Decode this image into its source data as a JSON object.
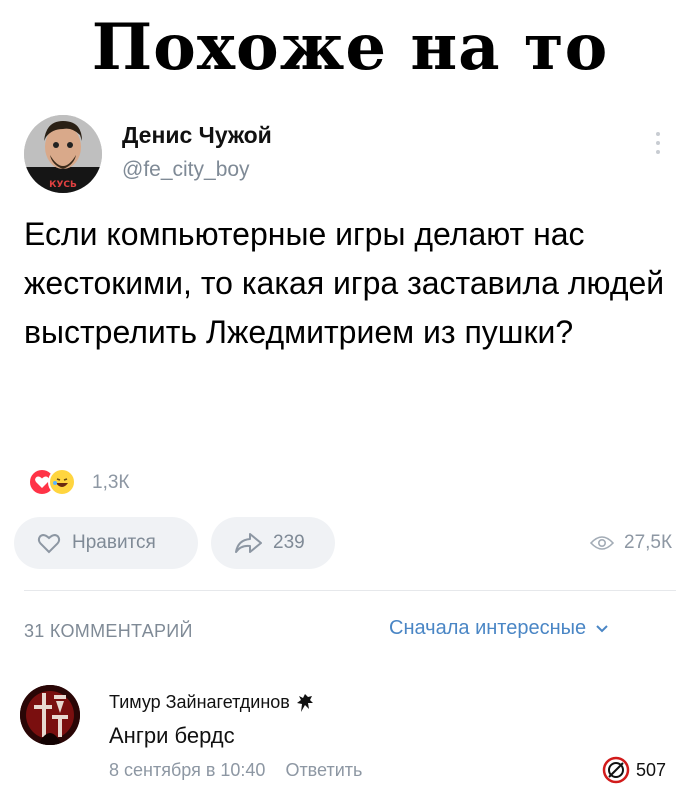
{
  "meme_caption": "Похоже на то",
  "post": {
    "author_name": "Денис Чужой",
    "author_handle": "@fe_city_boy",
    "text": "Если компьютерные игры делают нас жестокими, то какая игра заставила людей выстрелить Лжедмитрием из пушки?",
    "avatar_shirt_text": "КУСЬ",
    "reaction_count": "1,3К",
    "like_label": "Нравится",
    "share_count": "239",
    "views_count": "27,5К"
  },
  "comments_header": {
    "count_label": "31 КОММЕНТАРИЙ",
    "sort_label": "Сначала интересные"
  },
  "comment": {
    "author": "Тимур Зайнагетдинов",
    "text": "Ангри бердс",
    "date": "8 сентября в 10:40",
    "reply_label": "Ответить",
    "likes": "507"
  },
  "colors": {
    "accent_blue": "#4a86c5",
    "muted_gray": "#8d97a3",
    "heart_red": "#ff3347",
    "laugh_yellow": "#ffd53f"
  },
  "icons": [
    "heart-reaction-icon",
    "laugh-reaction-icon",
    "heart-outline-icon",
    "share-arrow-icon",
    "eye-icon",
    "chevron-down-icon",
    "kebab-menu-icon",
    "team-badge-icon",
    "ban-badge-icon"
  ]
}
